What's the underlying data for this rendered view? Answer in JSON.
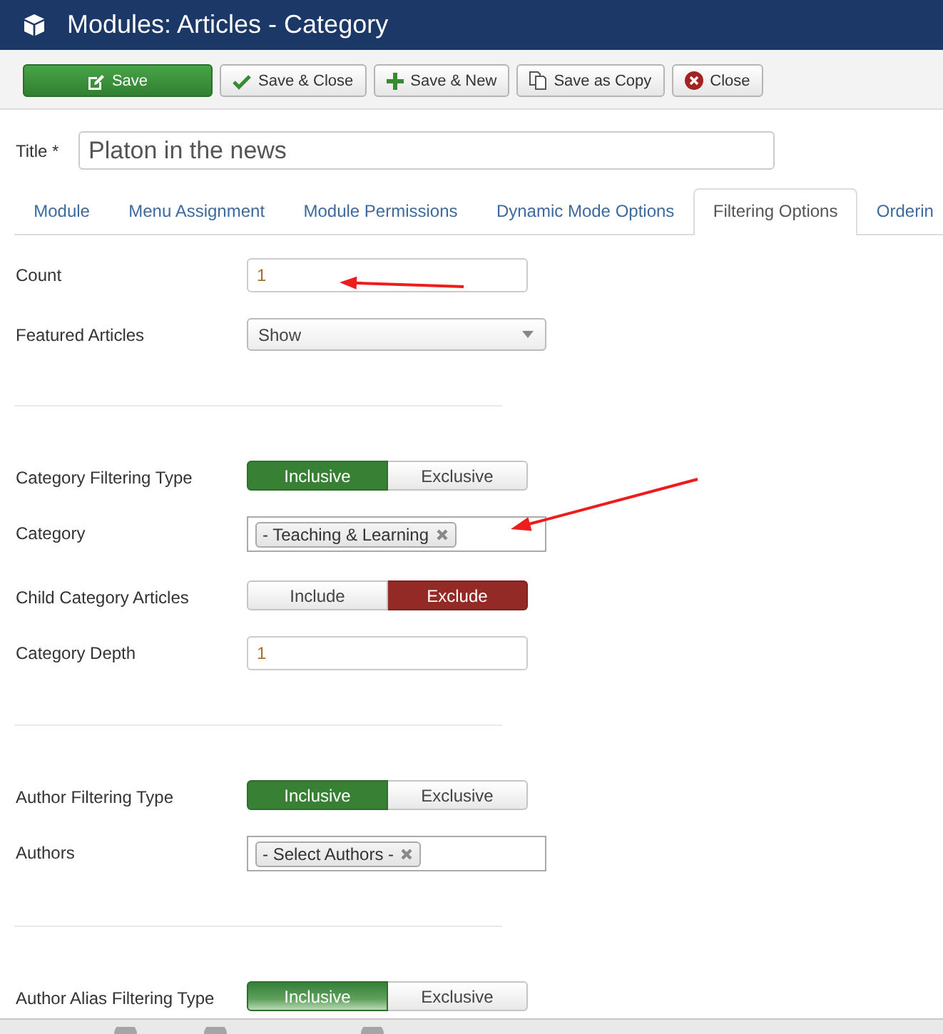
{
  "header": {
    "title": "Modules: Articles - Category"
  },
  "toolbar": [
    {
      "kind": "save",
      "label": "Save"
    },
    {
      "kind": "save-close",
      "label": "Save & Close"
    },
    {
      "kind": "save-new",
      "label": "Save & New"
    },
    {
      "kind": "save-copy",
      "label": "Save as Copy"
    },
    {
      "kind": "close",
      "label": "Close"
    }
  ],
  "title_field": {
    "label": "Title *",
    "value": "Platon in the news"
  },
  "tabs": [
    {
      "label": "Module",
      "selected": false
    },
    {
      "label": "Menu Assignment",
      "selected": false
    },
    {
      "label": "Module Permissions",
      "selected": false
    },
    {
      "label": "Dynamic Mode Options",
      "selected": false
    },
    {
      "label": "Filtering Options",
      "selected": true
    },
    {
      "label": "Orderin",
      "selected": false
    }
  ],
  "sections": [
    {
      "fields": [
        {
          "kind": "text",
          "label": "Count",
          "value": "1",
          "annotated": true
        },
        {
          "kind": "select",
          "label": "Featured Articles",
          "value": "Show",
          "annotated": false
        }
      ]
    },
    {
      "fields": [
        {
          "kind": "toggle",
          "label": "Category Filtering Type",
          "annotated": false,
          "options": [
            {
              "label": "Inclusive",
              "kind": "success",
              "selected": true
            },
            {
              "label": "Exclusive",
              "kind": "danger",
              "selected": false
            }
          ]
        },
        {
          "kind": "tags",
          "label": "Category",
          "tags": [
            "- Teaching & Learning"
          ],
          "annotated": true
        },
        {
          "kind": "toggle",
          "label": "Child Category Articles",
          "annotated": false,
          "options": [
            {
              "label": "Include",
              "kind": "success",
              "selected": false
            },
            {
              "label": "Exclude",
              "kind": "danger",
              "selected": true
            }
          ]
        },
        {
          "kind": "text",
          "label": "Category Depth",
          "value": "1",
          "annotated": false
        }
      ]
    },
    {
      "fields": [
        {
          "kind": "toggle",
          "label": "Author Filtering Type",
          "annotated": false,
          "options": [
            {
              "label": "Inclusive",
              "kind": "success",
              "selected": true
            },
            {
              "label": "Exclusive",
              "kind": "danger",
              "selected": false
            }
          ]
        },
        {
          "kind": "tags",
          "label": "Authors",
          "tags": [
            "- Select Authors -"
          ],
          "annotated": false
        }
      ]
    },
    {
      "fields": [
        {
          "kind": "toggle",
          "label": "Author Alias Filtering Type",
          "annotated": false,
          "options": [
            {
              "label": "Inclusive",
              "kind": "success",
              "selected": true,
              "hovered": true
            },
            {
              "label": "Exclusive",
              "kind": "danger",
              "selected": false,
              "hovered": false
            }
          ]
        }
      ]
    }
  ]
}
